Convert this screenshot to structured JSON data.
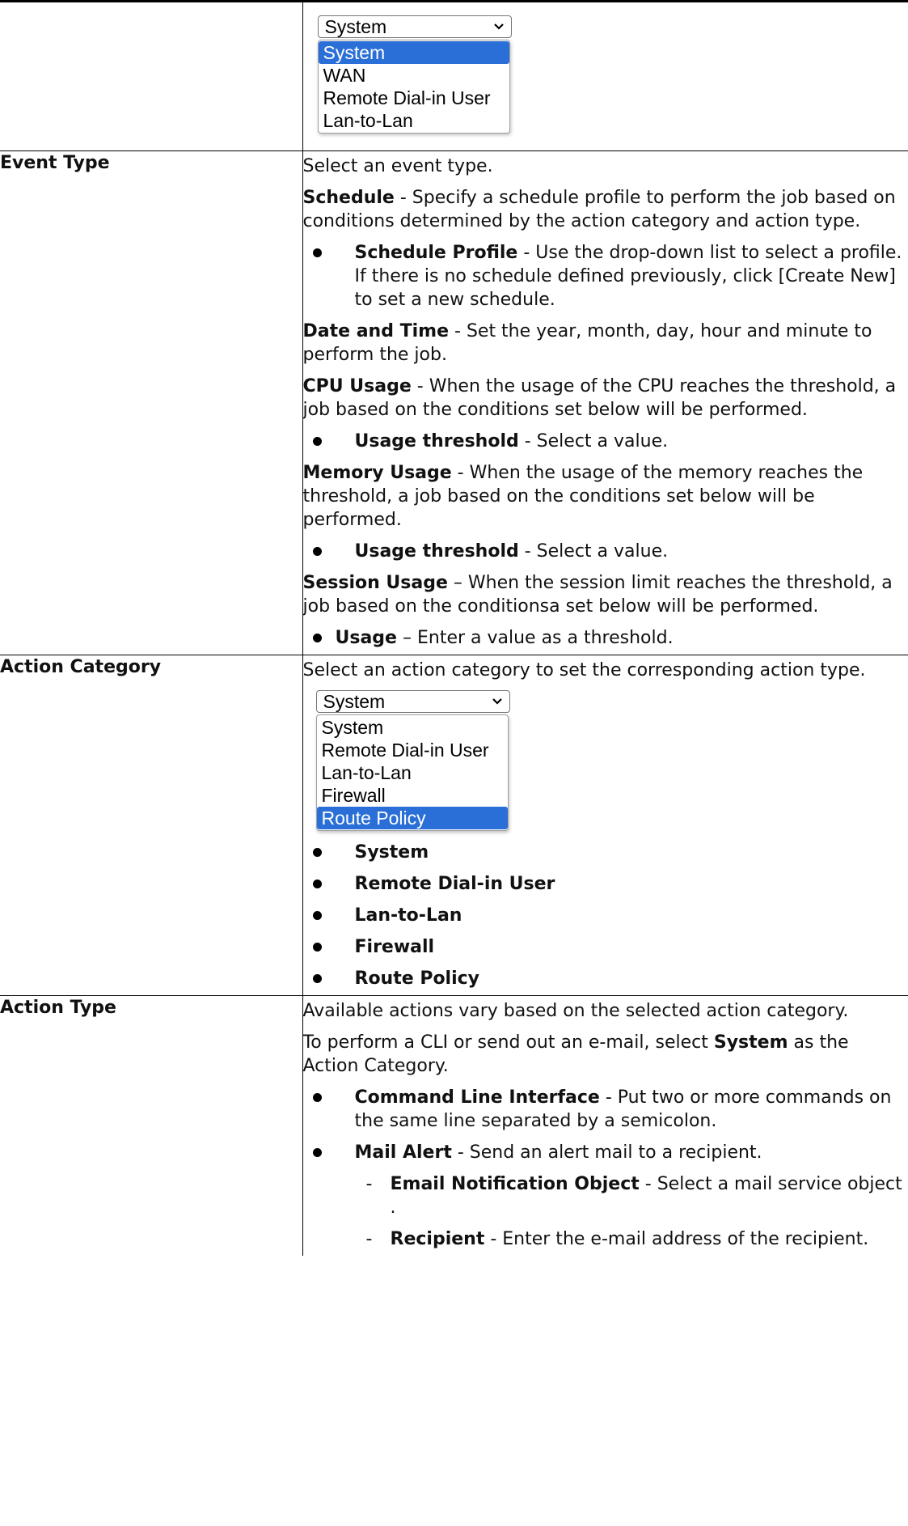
{
  "dropdown1": {
    "selected": "System",
    "options": [
      "System",
      "WAN",
      "Remote Dial-in User",
      "Lan-to-Lan"
    ],
    "highlighted_index": 0
  },
  "event_type": {
    "label": "Event Type",
    "intro": "Select an event type.",
    "schedule": {
      "term": "Schedule",
      "text": " - Specify a schedule profile to perform the job based on conditions determined by the action category and action type."
    },
    "schedule_profile": {
      "term": "Schedule Profile",
      "text": " - Use the drop-down list to select a profile. If there is no schedule defined previously, click [Create New] to set a new schedule."
    },
    "date_time": {
      "term": "Date and Time",
      "text": " - Set the year, month, day, hour and minute to perform the job."
    },
    "cpu": {
      "term": "CPU Usage",
      "text": " - When the usage of the CPU reaches the threshold, a job based on the conditions set below will be performed."
    },
    "cpu_threshold": {
      "term": "Usage threshold",
      "text": " - Select a value."
    },
    "memory": {
      "term": "Memory Usage",
      "text": " - When the usage of the memory reaches the threshold, a job based on the conditions set below will be performed."
    },
    "memory_threshold": {
      "term": "Usage threshold",
      "text": " - Select a value."
    },
    "session": {
      "term": "Session Usage",
      "text": " – When the session limit reaches the threshold, a job based on the conditionsa set below will be performed."
    },
    "session_usage": {
      "term": "Usage",
      "text": " – Enter a value as a threshold."
    }
  },
  "action_category": {
    "label": "Action Category",
    "intro": "Select an action category to set the corresponding action type.",
    "dropdown": {
      "selected": "System",
      "options": [
        "System",
        "Remote Dial-in User",
        "Lan-to-Lan",
        "Firewall",
        "Route Policy"
      ],
      "highlighted_index": 4
    },
    "items": [
      "System",
      "Remote Dial-in User",
      "Lan-to-Lan",
      "Firewall",
      "Route Policy"
    ]
  },
  "action_type": {
    "label": "Action Type",
    "intro": "Available actions vary based on the selected action category.",
    "cli_intro_pre": "To perform a CLI or send out an e-mail, select ",
    "cli_intro_term": "System",
    "cli_intro_post": " as the Action Category.",
    "cli": {
      "term": "Command Line Interface",
      "text": " - Put two or more commands on the same line separated by a semicolon."
    },
    "mail": {
      "term": "Mail Alert",
      "text": " - Send an alert mail to a recipient."
    },
    "email_obj": {
      "term": "Email Notification Object",
      "text": " - Select a mail service object ."
    },
    "recipient": {
      "term": "Recipient",
      "text": " - Enter the e-mail address of the recipient."
    }
  },
  "icons": {
    "chevron": "chevron-down-icon",
    "bullet": "bullet-dot"
  }
}
